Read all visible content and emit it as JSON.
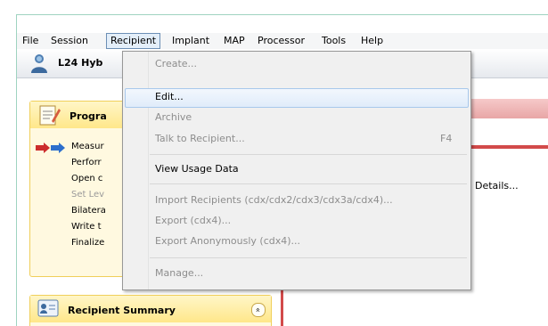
{
  "menubar": {
    "items": [
      "File",
      "Session",
      "Recipient",
      "Implant",
      "MAP",
      "Processor",
      "Tools",
      "Help"
    ]
  },
  "titlebar": {
    "title": "L24 Hyb"
  },
  "program_panel": {
    "title": "Progra",
    "tasks": [
      "Measur",
      "Perforr",
      "Open c",
      "Set Lev",
      "Bilatera",
      "Write t",
      "Finalize"
    ]
  },
  "summary_panel": {
    "title": "Recipient Summary",
    "collapse_glyph": "»"
  },
  "details_button": {
    "label": "Details..."
  },
  "recipient_menu": {
    "items": [
      {
        "label": "Create...",
        "enabled": false
      },
      {
        "label": "Edit...",
        "enabled": true,
        "highlighted": true
      },
      {
        "label": "Archive",
        "enabled": false
      },
      {
        "label": "Talk to Recipient...",
        "enabled": false,
        "shortcut": "F4"
      },
      {
        "label": "View Usage Data",
        "enabled": true
      },
      {
        "label": "Import Recipients (cdx/cdx2/cdx3/cdx3a/cdx4)...",
        "enabled": false
      },
      {
        "label": "Export (cdx4)...",
        "enabled": false
      },
      {
        "label": "Export Anonymously (cdx4)...",
        "enabled": false
      },
      {
        "label": "Manage...",
        "enabled": false
      }
    ]
  },
  "colors": {
    "accent_red": "#d24a4a",
    "panel_yellow": "#ffe78a",
    "menu_highlight": "#e0ecfa"
  }
}
